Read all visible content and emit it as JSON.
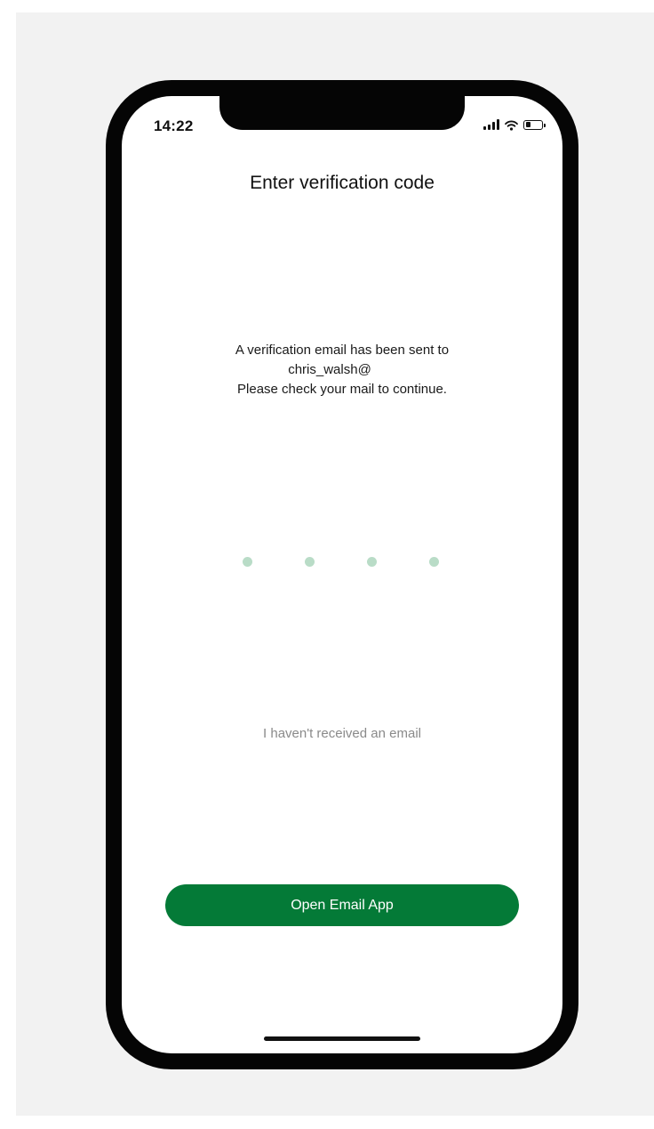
{
  "status_bar": {
    "time": "14:22",
    "icons": [
      "signal-icon",
      "wifi-icon",
      "battery-icon"
    ]
  },
  "screen": {
    "title": "Enter verification code",
    "message_lines": [
      "A verification email has been sent to",
      "chris_walsh@",
      "Please check your mail to continue."
    ],
    "code_length": 4,
    "resend_link": "I haven't received an email",
    "primary_button": "Open Email App"
  },
  "colors": {
    "accent": "#047a37",
    "code_dot": "#b9dcc7",
    "link_text": "#8a8a8a",
    "background": "#f2f2f2",
    "phone_frame": "#050505"
  }
}
